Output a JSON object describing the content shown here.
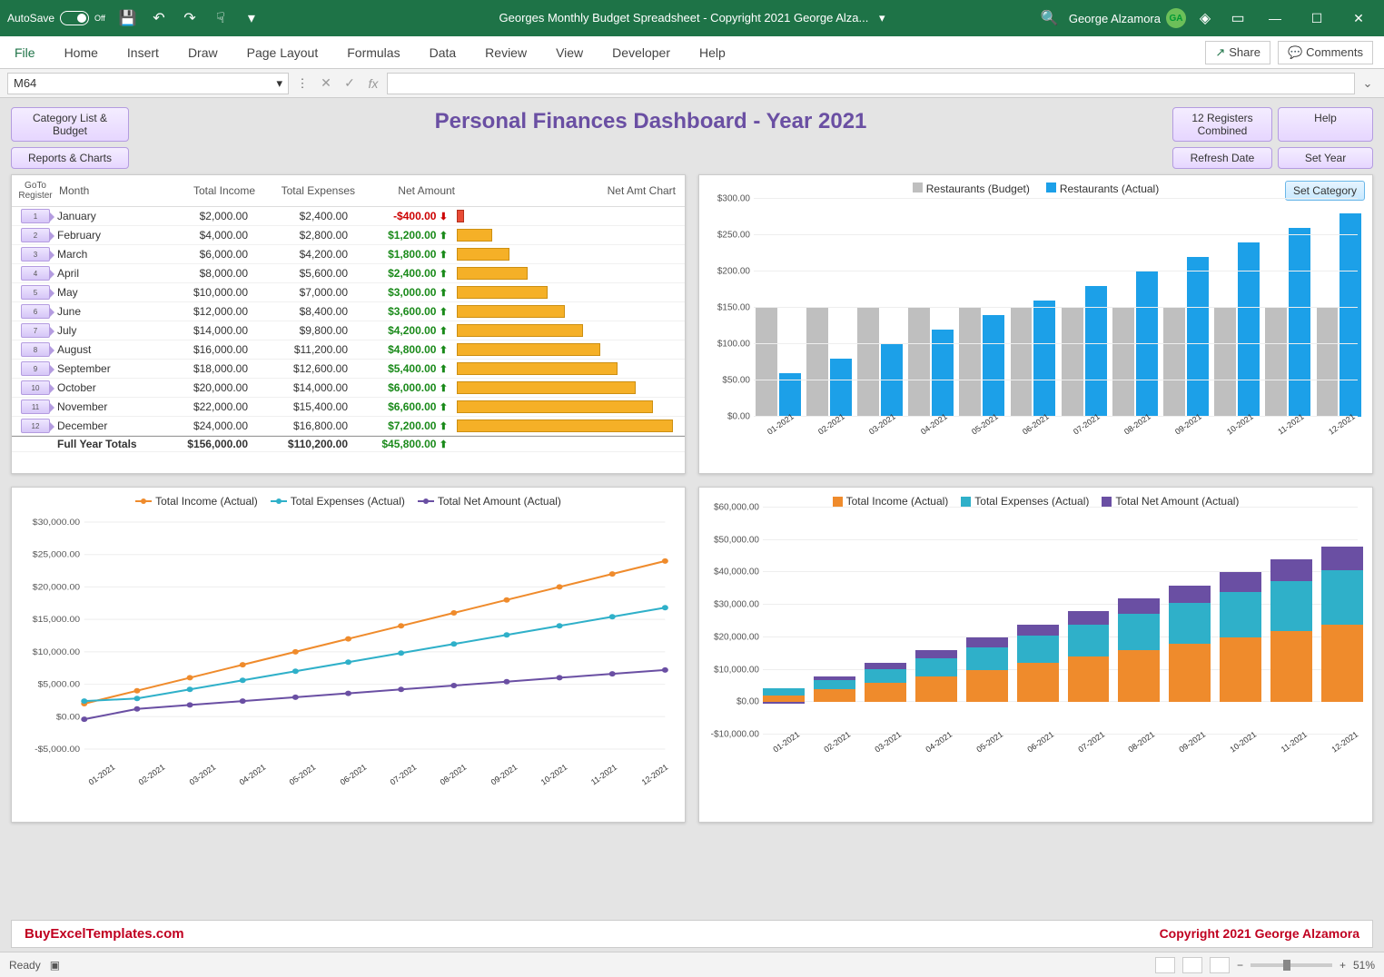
{
  "titlebar": {
    "autosave_label": "AutoSave",
    "autosave_state": "Off",
    "doc_title": "Georges Monthly Budget Spreadsheet - Copyright 2021 George Alza...",
    "user_name": "George Alzamora",
    "user_initials": "GA"
  },
  "tabs": {
    "items": [
      "File",
      "Home",
      "Insert",
      "Draw",
      "Page Layout",
      "Formulas",
      "Data",
      "Review",
      "View",
      "Developer",
      "Help"
    ],
    "share": "Share",
    "comments": "Comments"
  },
  "formulabar": {
    "namebox_value": "M64",
    "fx": "fx"
  },
  "dashboard": {
    "title": "Personal Finances Dashboard - Year 2021",
    "buttons": {
      "category_list": "Category List & Budget",
      "reports": "Reports & Charts",
      "registers": "12 Registers Combined",
      "help": "Help",
      "refresh": "Refresh Date",
      "set_year": "Set Year",
      "set_category": "Set Category"
    },
    "table": {
      "headers": {
        "goto": "GoTo\nRegister",
        "month": "Month",
        "income": "Total Income",
        "expenses": "Total Expenses",
        "net": "Net Amount",
        "chart": "Net Amt Chart"
      },
      "rows": [
        {
          "n": "1",
          "month": "January",
          "income": "$2,000.00",
          "expenses": "$2,400.00",
          "net": "-$400.00",
          "dir": "down",
          "bar": 5,
          "cls": "neg"
        },
        {
          "n": "2",
          "month": "February",
          "income": "$4,000.00",
          "expenses": "$2,800.00",
          "net": "$1,200.00",
          "dir": "up",
          "bar": 16,
          "cls": "pos"
        },
        {
          "n": "3",
          "month": "March",
          "income": "$6,000.00",
          "expenses": "$4,200.00",
          "net": "$1,800.00",
          "dir": "up",
          "bar": 24,
          "cls": "pos"
        },
        {
          "n": "4",
          "month": "April",
          "income": "$8,000.00",
          "expenses": "$5,600.00",
          "net": "$2,400.00",
          "dir": "up",
          "bar": 32,
          "cls": "pos"
        },
        {
          "n": "5",
          "month": "May",
          "income": "$10,000.00",
          "expenses": "$7,000.00",
          "net": "$3,000.00",
          "dir": "up",
          "bar": 41,
          "cls": "pos"
        },
        {
          "n": "6",
          "month": "June",
          "income": "$12,000.00",
          "expenses": "$8,400.00",
          "net": "$3,600.00",
          "dir": "up",
          "bar": 49,
          "cls": "pos"
        },
        {
          "n": "7",
          "month": "July",
          "income": "$14,000.00",
          "expenses": "$9,800.00",
          "net": "$4,200.00",
          "dir": "up",
          "bar": 57,
          "cls": "pos"
        },
        {
          "n": "8",
          "month": "August",
          "income": "$16,000.00",
          "expenses": "$11,200.00",
          "net": "$4,800.00",
          "dir": "up",
          "bar": 65,
          "cls": "pos"
        },
        {
          "n": "9",
          "month": "September",
          "income": "$18,000.00",
          "expenses": "$12,600.00",
          "net": "$5,400.00",
          "dir": "up",
          "bar": 73,
          "cls": "pos"
        },
        {
          "n": "10",
          "month": "October",
          "income": "$20,000.00",
          "expenses": "$14,000.00",
          "net": "$6,000.00",
          "dir": "up",
          "bar": 81,
          "cls": "pos"
        },
        {
          "n": "11",
          "month": "November",
          "income": "$22,000.00",
          "expenses": "$15,400.00",
          "net": "$6,600.00",
          "dir": "up",
          "bar": 89,
          "cls": "pos"
        },
        {
          "n": "12",
          "month": "December",
          "income": "$24,000.00",
          "expenses": "$16,800.00",
          "net": "$7,200.00",
          "dir": "up",
          "bar": 98,
          "cls": "pos"
        }
      ],
      "totals": {
        "label": "Full Year Totals",
        "income": "$156,000.00",
        "expenses": "$110,200.00",
        "net": "$45,800.00",
        "dir": "up"
      }
    },
    "brand": {
      "left": "BuyExcelTemplates.com",
      "right": "Copyright 2021  George Alzamora"
    }
  },
  "statusbar": {
    "ready": "Ready",
    "zoom": "51%"
  },
  "chart_data": [
    {
      "id": "restaurants",
      "type": "bar",
      "title": "",
      "legend": [
        "Restaurants (Budget)",
        "Restaurants (Actual)"
      ],
      "categories": [
        "01-2021",
        "02-2021",
        "03-2021",
        "04-2021",
        "05-2021",
        "06-2021",
        "07-2021",
        "08-2021",
        "09-2021",
        "10-2021",
        "11-2021",
        "12-2021"
      ],
      "series": [
        {
          "name": "Restaurants (Budget)",
          "color": "#bfbfbf",
          "values": [
            150,
            150,
            150,
            150,
            150,
            150,
            150,
            150,
            150,
            150,
            150,
            150
          ]
        },
        {
          "name": "Restaurants (Actual)",
          "color": "#1ca0e8",
          "values": [
            60,
            80,
            100,
            120,
            140,
            160,
            180,
            200,
            220,
            240,
            260,
            280
          ]
        }
      ],
      "ylim": [
        0,
        300
      ],
      "yticks": [
        "$0.00",
        "$50.00",
        "$100.00",
        "$150.00",
        "$200.00",
        "$250.00",
        "$300.00"
      ]
    },
    {
      "id": "line-totals",
      "type": "line",
      "legend": [
        "Total Income (Actual)",
        "Total Expenses (Actual)",
        "Total Net Amount (Actual)"
      ],
      "categories": [
        "01-2021",
        "02-2021",
        "03-2021",
        "04-2021",
        "05-2021",
        "06-2021",
        "07-2021",
        "08-2021",
        "09-2021",
        "10-2021",
        "11-2021",
        "12-2021"
      ],
      "series": [
        {
          "name": "Total Income (Actual)",
          "color": "#ef8b2c",
          "values": [
            2000,
            4000,
            6000,
            8000,
            10000,
            12000,
            14000,
            16000,
            18000,
            20000,
            22000,
            24000
          ]
        },
        {
          "name": "Total Expenses (Actual)",
          "color": "#2fb0c9",
          "values": [
            2400,
            2800,
            4200,
            5600,
            7000,
            8400,
            9800,
            11200,
            12600,
            14000,
            15400,
            16800
          ]
        },
        {
          "name": "Total Net Amount (Actual)",
          "color": "#6a4fa3",
          "values": [
            -400,
            1200,
            1800,
            2400,
            3000,
            3600,
            4200,
            4800,
            5400,
            6000,
            6600,
            7200
          ]
        }
      ],
      "ylim": [
        -5000,
        30000
      ],
      "yticks": [
        "-$5,000.00",
        "$0.00",
        "$5,000.00",
        "$10,000.00",
        "$15,000.00",
        "$20,000.00",
        "$25,000.00",
        "$30,000.00"
      ]
    },
    {
      "id": "stacked-totals",
      "type": "bar",
      "stacked": true,
      "legend": [
        "Total Income (Actual)",
        "Total Expenses (Actual)",
        "Total Net Amount (Actual)"
      ],
      "categories": [
        "01-2021",
        "02-2021",
        "03-2021",
        "04-2021",
        "05-2021",
        "06-2021",
        "07-2021",
        "08-2021",
        "09-2021",
        "10-2021",
        "11-2021",
        "12-2021"
      ],
      "series": [
        {
          "name": "Total Income (Actual)",
          "color": "#ef8b2c",
          "values": [
            2000,
            4000,
            6000,
            8000,
            10000,
            12000,
            14000,
            16000,
            18000,
            20000,
            22000,
            24000
          ]
        },
        {
          "name": "Total Expenses (Actual)",
          "color": "#2fb0c9",
          "values": [
            2400,
            2800,
            4200,
            5600,
            7000,
            8400,
            9800,
            11200,
            12600,
            14000,
            15400,
            16800
          ]
        },
        {
          "name": "Total Net Amount (Actual)",
          "color": "#6a4fa3",
          "values": [
            -400,
            1200,
            1800,
            2400,
            3000,
            3600,
            4200,
            4800,
            5400,
            6000,
            6600,
            7200
          ]
        }
      ],
      "ylim": [
        -10000,
        60000
      ],
      "yticks": [
        "-$10,000.00",
        "$0.00",
        "$10,000.00",
        "$20,000.00",
        "$30,000.00",
        "$40,000.00",
        "$50,000.00",
        "$60,000.00"
      ]
    }
  ]
}
